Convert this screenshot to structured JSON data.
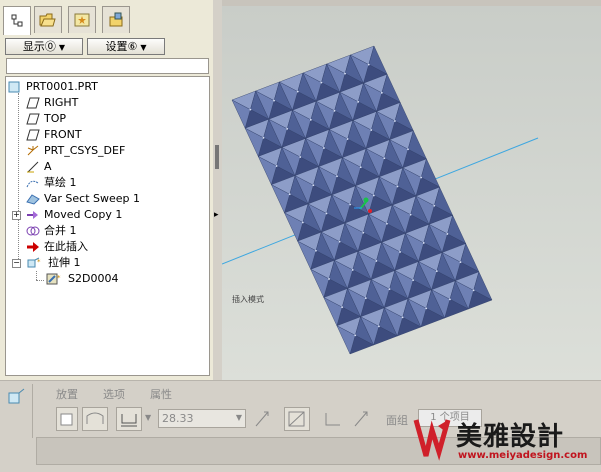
{
  "left_panel": {
    "tabs": [
      {
        "name": "model-tree",
        "active": true
      },
      {
        "name": "folder-browser",
        "active": false
      },
      {
        "name": "favorites",
        "active": false
      },
      {
        "name": "connections",
        "active": false
      }
    ],
    "show_button_label": "显示⓪",
    "settings_button_label": "设置⑥",
    "tree": {
      "root": "PRT0001.PRT",
      "items": [
        {
          "label": "RIGHT",
          "icon": "datum-plane-icon"
        },
        {
          "label": "TOP",
          "icon": "datum-plane-icon"
        },
        {
          "label": "FRONT",
          "icon": "datum-plane-icon"
        },
        {
          "label": "PRT_CSYS_DEF",
          "icon": "csys-icon"
        },
        {
          "label": "A",
          "icon": "axis-icon"
        },
        {
          "label": "草绘 1",
          "icon": "sketch-icon"
        },
        {
          "label": "Var Sect Sweep 1",
          "icon": "sweep-icon"
        },
        {
          "label": "Moved Copy 1",
          "icon": "moved-copy-icon"
        },
        {
          "label": "合并 1",
          "icon": "merge-icon"
        },
        {
          "label": "在此插入",
          "icon": "insert-here-icon"
        },
        {
          "label": "拉伸 1",
          "icon": "extrude-icon"
        },
        {
          "label": "S2D0004",
          "icon": "sketch-section-icon"
        }
      ]
    }
  },
  "viewport": {
    "annotation": "插入模式",
    "background": "#d4d8d2",
    "surface_color": "#5d6f9f",
    "axis_line_color": "#3ea7e0"
  },
  "dashboard": {
    "tabs": [
      "放置",
      "选项",
      "属性"
    ],
    "depth_value": "28.33",
    "thicken_label": "面组",
    "collector_text": "1 个项目"
  },
  "watermark": {
    "brand": "美雅設計",
    "url": "www.meiyadesign.com"
  }
}
